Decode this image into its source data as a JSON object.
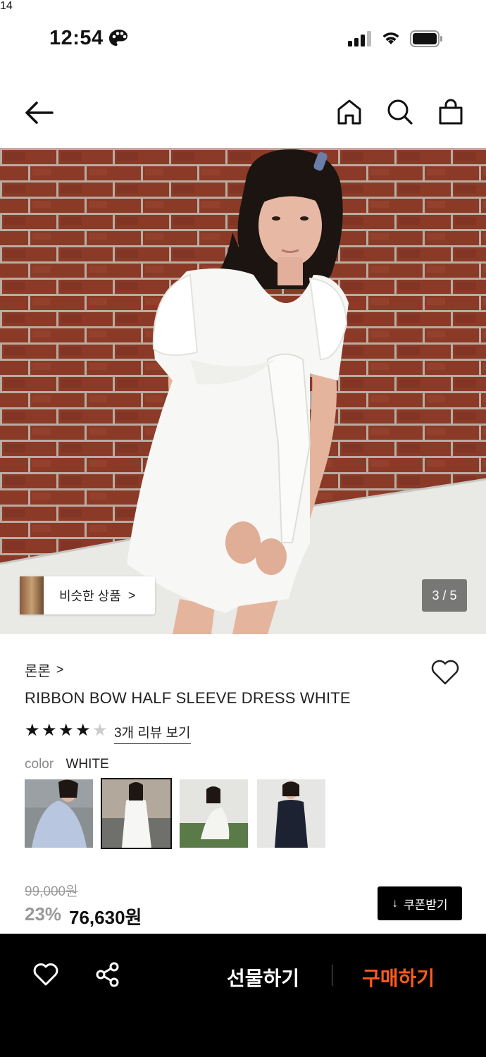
{
  "status_bar": {
    "time": "12:54"
  },
  "header": {
    "cart_count": "14"
  },
  "hero": {
    "similar_label": "비슷한 상품",
    "similar_chevron": ">",
    "counter": "3 / 5"
  },
  "product": {
    "brand": "론론",
    "brand_chevron": ">",
    "title": "RIBBON BOW HALF SLEEVE DRESS WHITE",
    "rating": 4,
    "rating_max": 5,
    "reviews_link": "3개 리뷰 보기",
    "color_key": "color",
    "color_value": "WHITE",
    "swatch_count": 4,
    "selected_swatch": 2
  },
  "price": {
    "original": "99,000원",
    "discount": "23%",
    "final": "76,630원",
    "coupon_label": "쿠폰받기",
    "coupon_icon": "↓"
  },
  "bottom_bar": {
    "gift_label": "선물하기",
    "buy_label": "구매하기"
  },
  "colors": {
    "accent": "#ff5a1f",
    "bar": "#000000"
  }
}
